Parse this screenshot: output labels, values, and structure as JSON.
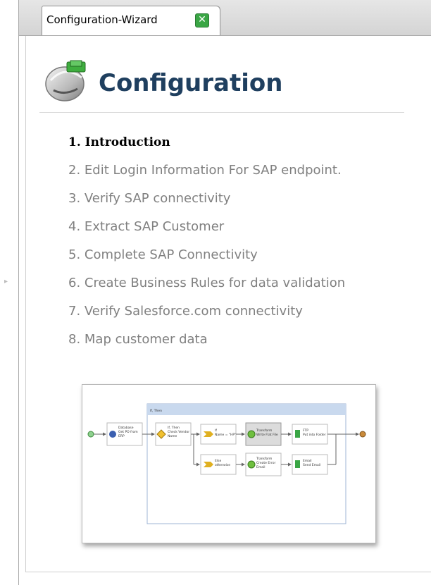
{
  "tab": {
    "label": "Configuration-Wizard",
    "close_icon": "close-icon",
    "close_color": "#3aa645"
  },
  "header": {
    "title": "Configuration",
    "icon": "wizard-disc-icon"
  },
  "steps": [
    {
      "label": "1. Introduction",
      "active": true
    },
    {
      "label": "2. Edit Login Information For SAP endpoint.",
      "active": false
    },
    {
      "label": "3. Verify SAP connectivity",
      "active": false
    },
    {
      "label": "4. Extract SAP Customer",
      "active": false
    },
    {
      "label": "5. Complete SAP Connectivity",
      "active": false
    },
    {
      "label": "6. Create Business Rules for data validation",
      "active": false
    },
    {
      "label": "7. Verify Salesforce.com connectivity",
      "active": false
    },
    {
      "label": "8. Map customer data",
      "active": false
    }
  ],
  "diagram": {
    "branch_title": "If, Then",
    "nodes": {
      "database": [
        "Database",
        "Get PO from",
        "ERP"
      ],
      "ifthen": [
        "If, Then",
        "Check Vendor",
        "Name"
      ],
      "if": [
        "If",
        "Name = \"HP\""
      ],
      "else": [
        "Else",
        "otherwise"
      ],
      "transform1": [
        "Transform",
        "Write Flat File"
      ],
      "transform2": [
        "Transform",
        "Create Error",
        "Email"
      ],
      "ftp": [
        "FTP",
        "Put into Folder"
      ],
      "email": [
        "Email",
        "Send Email"
      ]
    }
  },
  "colors": {
    "title": "#1f3f5f",
    "inactive_step": "#808080",
    "active_step": "#000000",
    "branch_header": "#c9d9ee"
  }
}
